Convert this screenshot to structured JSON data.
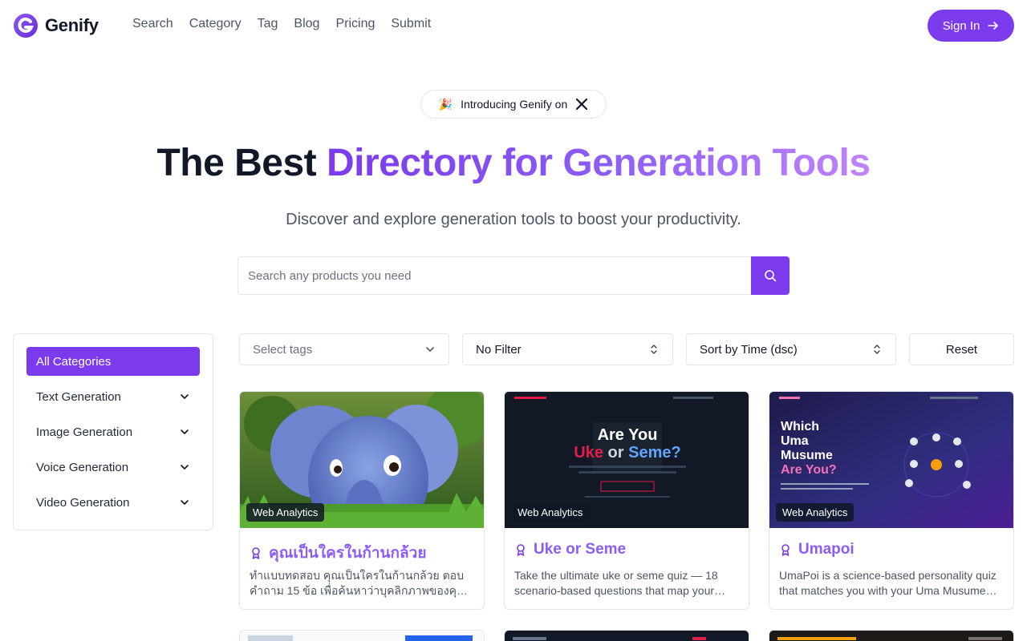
{
  "brand": {
    "name": "Genify",
    "accent": "#7c3aed"
  },
  "nav": {
    "items": [
      "Search",
      "Category",
      "Tag",
      "Blog",
      "Pricing",
      "Submit"
    ]
  },
  "signin": {
    "label": "Sign In"
  },
  "announce": {
    "emoji": "🎉",
    "text": "Introducing Genify on"
  },
  "hero": {
    "title_plain": "The Best ",
    "title_gradient": "Directory for Generation Tools",
    "subtitle": "Discover and explore generation tools to boost your productivity."
  },
  "search": {
    "placeholder": "Search any products you need"
  },
  "sidebar": {
    "items": [
      {
        "label": "All Categories",
        "active": true
      },
      {
        "label": "Text Generation"
      },
      {
        "label": "Image Generation"
      },
      {
        "label": "Voice Generation"
      },
      {
        "label": "Video Generation"
      }
    ]
  },
  "filters": {
    "tags_placeholder": "Select tags",
    "filter_value": "No Filter",
    "sort_value": "Sort by Time (dsc)",
    "reset_label": "Reset"
  },
  "cards": [
    {
      "badge": "Web Analytics",
      "title": "คุณเป็นใครในก้านกล้วย",
      "desc": "ทำแบบทดสอบ คุณเป็นใครในก้านกล้วย ตอบคำถาม 15 ข้อ เพื่อค้นหาว่าบุคลิกภาพของคุณตรงกับตัวละครไหน"
    },
    {
      "badge": "Web Analytics",
      "title": "Uke or Seme",
      "desc": "Take the ultimate uke or seme quiz — 18 scenario-based questions that map your personality",
      "img_text": {
        "line1": "Are You",
        "uke": "Uke",
        "or": " or ",
        "seme": "Seme?"
      }
    },
    {
      "badge": "Web Analytics",
      "title": "Umapoi",
      "desc": "UmaPoi is a science-based personality quiz that matches you with your Uma Musume character",
      "img_text": {
        "line1": "Which",
        "line2": "Uma",
        "line3": "Musume",
        "line4": "Are You?"
      }
    }
  ]
}
